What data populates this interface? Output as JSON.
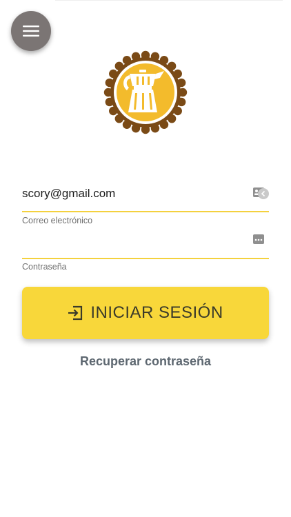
{
  "menu": {
    "icon": "hamburger-menu-icon"
  },
  "logo": {
    "icon": "moka-pot-badge-logo",
    "colors": {
      "ring": "#7a4a16",
      "fill": "#f3bb2c",
      "inner_ring": "#ffffff"
    }
  },
  "login_form": {
    "email": {
      "value": "scory@gmail.com",
      "label": "Correo electrónico"
    },
    "password": {
      "value": "",
      "label": "Contraseña"
    },
    "submit": {
      "label": "INICIAR SESIÓN",
      "icon": "login-arrow-icon"
    },
    "recover_label": "Recuperar contraseña"
  },
  "colors": {
    "accent": "#f8d73a",
    "underline": "#f4d13e",
    "fab": "#7b7574",
    "link": "#5d6770"
  }
}
